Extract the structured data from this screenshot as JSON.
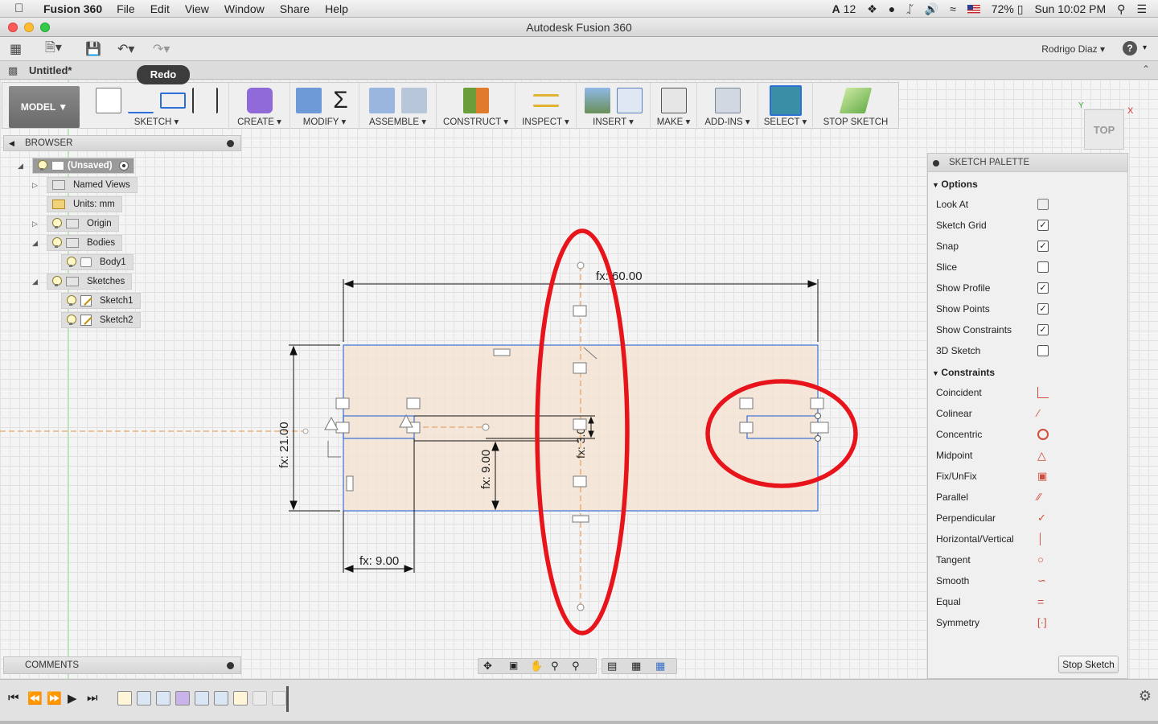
{
  "menubar": {
    "app_name": "Fusion 360",
    "items": [
      "File",
      "Edit",
      "View",
      "Window",
      "Share",
      "Help"
    ],
    "status": {
      "adobe_count": "12",
      "battery": "72%",
      "clock": "Sun 10:02 PM"
    }
  },
  "window": {
    "title": "Autodesk Fusion 360"
  },
  "toolbar": {
    "user": "Rodrigo Diaz",
    "help": "?"
  },
  "document": {
    "name": "Untitled*"
  },
  "tooltip": {
    "text": "Redo"
  },
  "ribbon": {
    "workspace": "MODEL ▼",
    "groups": [
      {
        "label": "SKETCH ▾"
      },
      {
        "label": "CREATE ▾"
      },
      {
        "label": "MODIFY ▾"
      },
      {
        "label": "ASSEMBLE ▾"
      },
      {
        "label": "CONSTRUCT ▾"
      },
      {
        "label": "INSPECT ▾"
      },
      {
        "label": "INSERT ▾"
      },
      {
        "label": "MAKE ▾"
      },
      {
        "label": "ADD-INS ▾"
      },
      {
        "label": "SELECT ▾"
      },
      {
        "label": "STOP SKETCH"
      }
    ]
  },
  "browser": {
    "header": "BROWSER",
    "nodes": {
      "root": "(Unsaved)",
      "named_views": "Named Views",
      "units": "Units: mm",
      "origin": "Origin",
      "bodies": "Bodies",
      "body1": "Body1",
      "sketches": "Sketches",
      "sketch1": "Sketch1",
      "sketch2": "Sketch2"
    }
  },
  "comments": {
    "header": "COMMENTS"
  },
  "viewcube": {
    "face": "TOP",
    "x": "X",
    "y": "Y"
  },
  "sketch": {
    "dimensions": {
      "width": "fx: 60.00",
      "height": "fx: 21.00",
      "inner": "fx: 9.00",
      "bottom": "fx: 9.00",
      "slot": "fx: 3.00"
    }
  },
  "palette": {
    "title": "SKETCH PALETTE",
    "options_header": "Options",
    "options": [
      {
        "label": "Look At",
        "checked": null
      },
      {
        "label": "Sketch Grid",
        "checked": true
      },
      {
        "label": "Snap",
        "checked": true
      },
      {
        "label": "Slice",
        "checked": false
      },
      {
        "label": "Show Profile",
        "checked": true
      },
      {
        "label": "Show Points",
        "checked": true
      },
      {
        "label": "Show Constraints",
        "checked": true
      },
      {
        "label": "3D Sketch",
        "checked": false
      }
    ],
    "constraints_header": "Constraints",
    "constraints": [
      {
        "label": "Coincident",
        "icon": "coincident-icon"
      },
      {
        "label": "Colinear",
        "icon": "colinear-icon"
      },
      {
        "label": "Concentric",
        "icon": "concentric-icon"
      },
      {
        "label": "Midpoint",
        "icon": "midpoint-icon"
      },
      {
        "label": "Fix/UnFix",
        "icon": "lock-icon"
      },
      {
        "label": "Parallel",
        "icon": "parallel-icon"
      },
      {
        "label": "Perpendicular",
        "icon": "perpendicular-icon"
      },
      {
        "label": "Horizontal/Vertical",
        "icon": "horizontal-vertical-icon"
      },
      {
        "label": "Tangent",
        "icon": "tangent-icon"
      },
      {
        "label": "Smooth",
        "icon": "smooth-icon"
      },
      {
        "label": "Equal",
        "icon": "equal-icon"
      },
      {
        "label": "Symmetry",
        "icon": "symmetry-icon"
      }
    ],
    "stop_button": "Stop Sketch"
  },
  "colors": {
    "accent_red": "#e8141b",
    "profile_fill": "#f3e3d3",
    "sketch_line": "#3b6fd4",
    "constraint_icon": "#d44b3a"
  }
}
